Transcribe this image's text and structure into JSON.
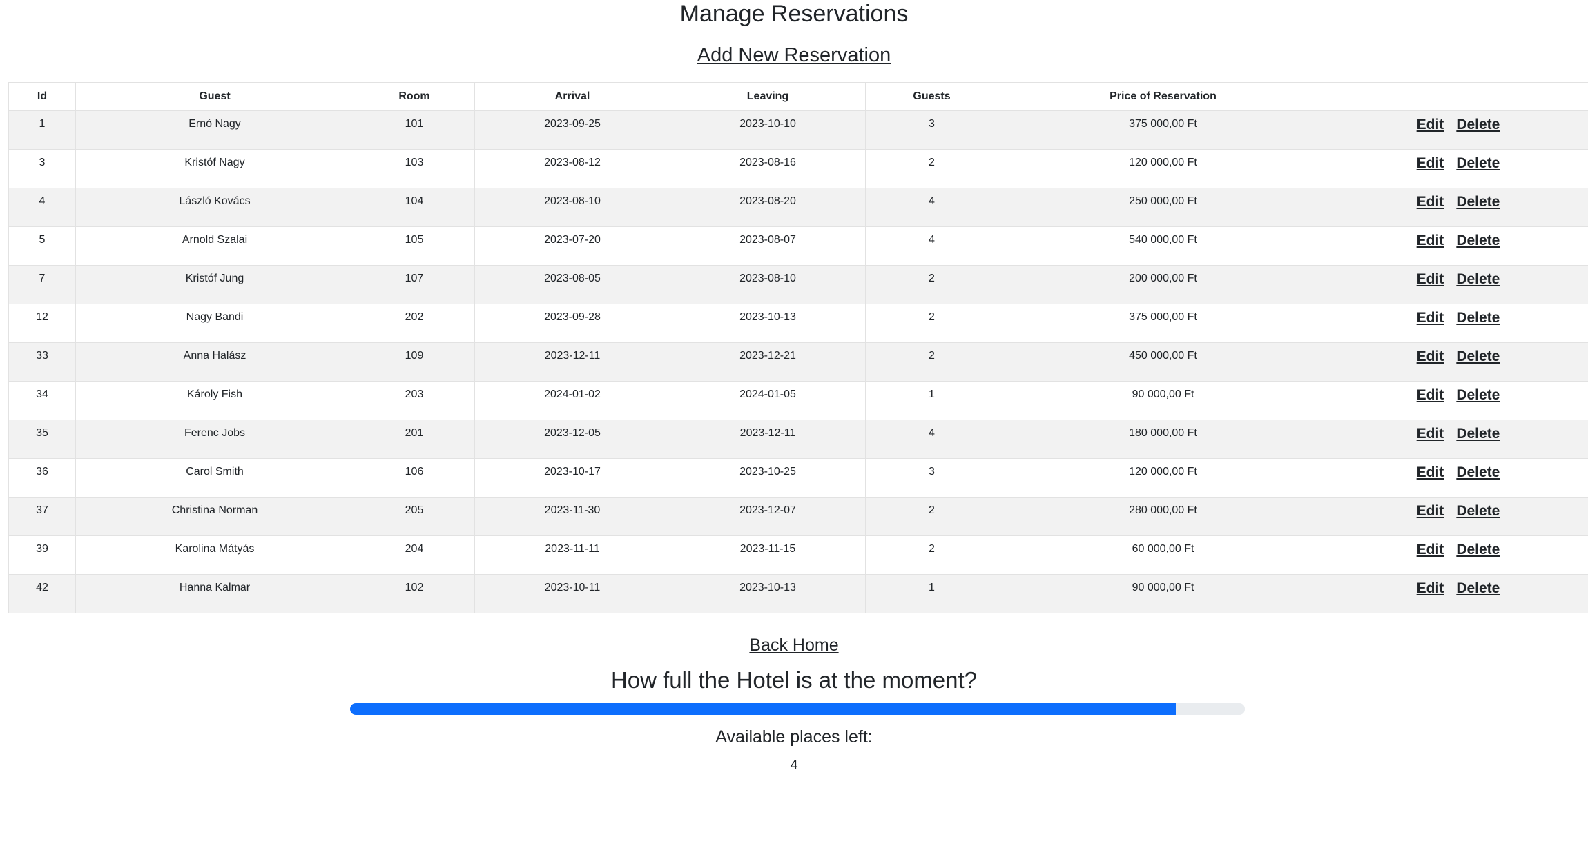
{
  "page": {
    "title": "Manage Reservations",
    "add_link": "Add New Reservation",
    "back_home": "Back Home"
  },
  "table": {
    "headers": [
      "Id",
      "Guest",
      "Room",
      "Arrival",
      "Leaving",
      "Guests",
      "Price of Reservation",
      ""
    ],
    "edit_label": "Edit",
    "delete_label": "Delete",
    "rows": [
      {
        "id": "1",
        "guest": "Ernó Nagy",
        "room": "101",
        "arrival": "2023-09-25",
        "leaving": "2023-10-10",
        "guests": "3",
        "price": "375 000,00 Ft"
      },
      {
        "id": "3",
        "guest": "Kristóf Nagy",
        "room": "103",
        "arrival": "2023-08-12",
        "leaving": "2023-08-16",
        "guests": "2",
        "price": "120 000,00 Ft"
      },
      {
        "id": "4",
        "guest": "László Kovács",
        "room": "104",
        "arrival": "2023-08-10",
        "leaving": "2023-08-20",
        "guests": "4",
        "price": "250 000,00 Ft"
      },
      {
        "id": "5",
        "guest": "Arnold Szalai",
        "room": "105",
        "arrival": "2023-07-20",
        "leaving": "2023-08-07",
        "guests": "4",
        "price": "540 000,00 Ft"
      },
      {
        "id": "7",
        "guest": "Kristóf Jung",
        "room": "107",
        "arrival": "2023-08-05",
        "leaving": "2023-08-10",
        "guests": "2",
        "price": "200 000,00 Ft"
      },
      {
        "id": "12",
        "guest": "Nagy Bandi",
        "room": "202",
        "arrival": "2023-09-28",
        "leaving": "2023-10-13",
        "guests": "2",
        "price": "375 000,00 Ft"
      },
      {
        "id": "33",
        "guest": "Anna Halász",
        "room": "109",
        "arrival": "2023-12-11",
        "leaving": "2023-12-21",
        "guests": "2",
        "price": "450 000,00 Ft"
      },
      {
        "id": "34",
        "guest": "Károly Fish",
        "room": "203",
        "arrival": "2024-01-02",
        "leaving": "2024-01-05",
        "guests": "1",
        "price": "90 000,00 Ft"
      },
      {
        "id": "35",
        "guest": "Ferenc Jobs",
        "room": "201",
        "arrival": "2023-12-05",
        "leaving": "2023-12-11",
        "guests": "4",
        "price": "180 000,00 Ft"
      },
      {
        "id": "36",
        "guest": "Carol Smith",
        "room": "106",
        "arrival": "2023-10-17",
        "leaving": "2023-10-25",
        "guests": "3",
        "price": "120 000,00 Ft"
      },
      {
        "id": "37",
        "guest": "Christina Norman",
        "room": "205",
        "arrival": "2023-11-30",
        "leaving": "2023-12-07",
        "guests": "2",
        "price": "280 000,00 Ft"
      },
      {
        "id": "39",
        "guest": "Karolina Mátyás",
        "room": "204",
        "arrival": "2023-11-11",
        "leaving": "2023-11-15",
        "guests": "2",
        "price": "60 000,00 Ft"
      },
      {
        "id": "42",
        "guest": "Hanna Kalmar",
        "room": "102",
        "arrival": "2023-10-11",
        "leaving": "2023-10-13",
        "guests": "1",
        "price": "90 000,00 Ft"
      }
    ]
  },
  "occupancy": {
    "title": "How full the Hotel is at the moment?",
    "fill_fraction": 0.923,
    "available_label": "Available places left:",
    "available_value": "4",
    "bar_color": "#0d6efd",
    "track_color": "#e9ecef"
  }
}
